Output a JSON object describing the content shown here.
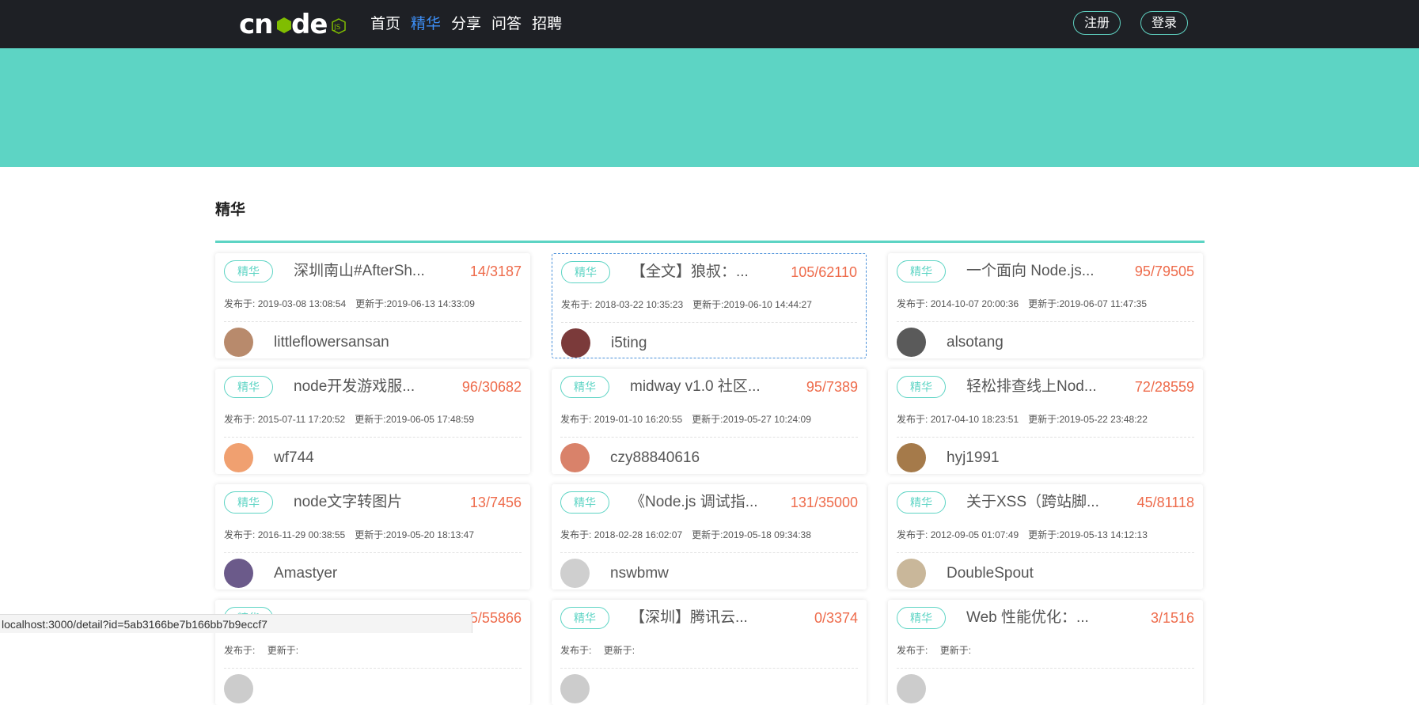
{
  "nav": {
    "items": [
      {
        "label": "首页",
        "active": false
      },
      {
        "label": "精华",
        "active": true
      },
      {
        "label": "分享",
        "active": false
      },
      {
        "label": "问答",
        "active": false
      },
      {
        "label": "招聘",
        "active": false
      }
    ],
    "register_label": "注册",
    "login_label": "登录",
    "logo_icon": "cnode-js-logo"
  },
  "colors": {
    "header_bg": "#1e2025",
    "banner": "#5dd4c4",
    "accent": "#5dd4c4",
    "active_nav": "#3d8ef5",
    "count": "#ee6b4b"
  },
  "section": {
    "title": "精华"
  },
  "topics": [
    {
      "tag": "精华",
      "title": "深圳南山#AfterSh...",
      "count": "14/3187",
      "published": "2019-03-08 13:08:54",
      "updated": "2019-06-13 14:33:09",
      "author": "littleflowersansan",
      "avatar_color": "#b88a6c"
    },
    {
      "tag": "精华",
      "title": "【全文】狼叔：...",
      "count": "105/62110",
      "published": "2018-03-22 10:35:23",
      "updated": "2019-06-10 14:44:27",
      "author": "i5ting",
      "avatar_color": "#7b3a3a"
    },
    {
      "tag": "精华",
      "title": "一个面向 Node.js...",
      "count": "95/79505",
      "published": "2014-10-07 20:00:36",
      "updated": "2019-06-07 11:47:35",
      "author": "alsotang",
      "avatar_color": "#5a5a5a"
    },
    {
      "tag": "精华",
      "title": "node开发游戏服...",
      "count": "96/30682",
      "published": "2015-07-11 17:20:52",
      "updated": "2019-06-05 17:48:59",
      "author": "wf744",
      "avatar_color": "#f0a070"
    },
    {
      "tag": "精华",
      "title": "midway v1.0 社区...",
      "count": "95/7389",
      "published": "2019-01-10 16:20:55",
      "updated": "2019-05-27 10:24:09",
      "author": "czy88840616",
      "avatar_color": "#d9826a"
    },
    {
      "tag": "精华",
      "title": "轻松排查线上Nod...",
      "count": "72/28559",
      "published": "2017-04-10 18:23:51",
      "updated": "2019-05-22 23:48:22",
      "author": "hyj1991",
      "avatar_color": "#a57a4a"
    },
    {
      "tag": "精华",
      "title": "node文字转图片",
      "count": "13/7456",
      "published": "2016-11-29 00:38:55",
      "updated": "2019-05-20 18:13:47",
      "author": "Amastyer",
      "avatar_color": "#6b5a8a"
    },
    {
      "tag": "精华",
      "title": "《Node.js 调试指...",
      "count": "131/35000",
      "published": "2018-02-28 16:02:07",
      "updated": "2019-05-18 09:34:38",
      "author": "nswbmw",
      "avatar_color": "#cfcfcf"
    },
    {
      "tag": "精华",
      "title": "关于XSS（跨站脚...",
      "count": "45/81118",
      "published": "2012-09-05 01:07:49",
      "updated": "2019-05-13 14:12:13",
      "author": "DoubleSpout",
      "avatar_color": "#c9b79a"
    },
    {
      "tag": "精华",
      "title": "",
      "count": "5/55866",
      "published": "",
      "updated": "",
      "author": "",
      "avatar_color": "#cccccc"
    },
    {
      "tag": "精华",
      "title": "【深圳】腾讯云...",
      "count": "0/3374",
      "published": "",
      "updated": "",
      "author": "",
      "avatar_color": "#cccccc"
    },
    {
      "tag": "精华",
      "title": "Web 性能优化：...",
      "count": "3/1516",
      "published": "",
      "updated": "",
      "author": "",
      "avatar_color": "#cccccc"
    }
  ],
  "labels": {
    "published": "发布于:",
    "updated": "更新于:"
  },
  "statusbar": {
    "url": "localhost:3000/detail?id=5ab3166be7b166bb7b9eccf7"
  }
}
